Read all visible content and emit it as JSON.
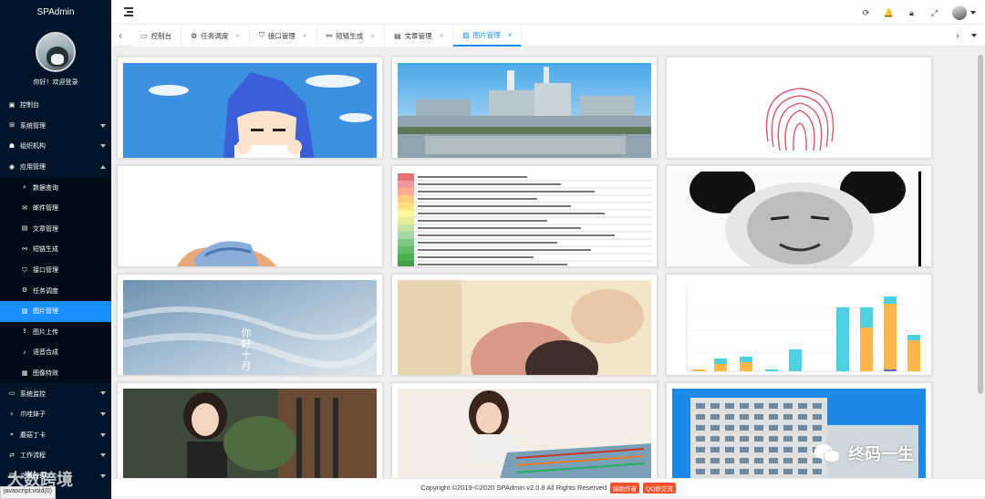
{
  "brand": "SPAdmin",
  "welcome": "你好！欢迎登录",
  "menu": [
    {
      "label": "控制台",
      "icon": "dashboard-icon",
      "type": "top"
    },
    {
      "label": "系统管理",
      "icon": "system-icon",
      "type": "top",
      "caret": "down"
    },
    {
      "label": "组织机构",
      "icon": "org-icon",
      "type": "top",
      "caret": "down"
    },
    {
      "label": "应用管理",
      "icon": "app-icon",
      "type": "top",
      "caret": "up"
    },
    {
      "label": "数据查询",
      "icon": "search-icon",
      "type": "sub"
    },
    {
      "label": "邮件管理",
      "icon": "mail-icon",
      "type": "sub"
    },
    {
      "label": "文章管理",
      "icon": "article-icon",
      "type": "sub"
    },
    {
      "label": "短链生成",
      "icon": "link-icon",
      "type": "sub"
    },
    {
      "label": "接口管理",
      "icon": "shield-icon",
      "type": "sub"
    },
    {
      "label": "任务调度",
      "icon": "gear-icon",
      "type": "sub"
    },
    {
      "label": "图片管理",
      "icon": "image-icon",
      "type": "sub",
      "active": true
    },
    {
      "label": "图片上传",
      "icon": "upload-icon",
      "type": "sub"
    },
    {
      "label": "语音合成",
      "icon": "voice-icon",
      "type": "sub"
    },
    {
      "label": "图像特效",
      "icon": "effect-icon",
      "type": "sub"
    },
    {
      "label": "系统监控",
      "icon": "monitor-icon",
      "type": "top",
      "caret": "down"
    },
    {
      "label": "爪哇妹子",
      "icon": "girl-icon",
      "type": "top",
      "caret": "down"
    },
    {
      "label": "蘑菇丁卡",
      "icon": "location-icon",
      "type": "top",
      "caret": "down"
    },
    {
      "label": "工作流程",
      "icon": "workflow-icon",
      "type": "top",
      "caret": "down"
    },
    {
      "label": "文章管理",
      "icon": "article-icon",
      "type": "top",
      "caret": "down"
    }
  ],
  "header_icons": [
    "refresh-icon",
    "bell-icon",
    "lock-icon",
    "fullscreen-icon"
  ],
  "tabs": [
    {
      "label": "控制台",
      "icon": "monitor-icon",
      "closable": false
    },
    {
      "label": "任务调度",
      "icon": "gear-icon",
      "closable": true
    },
    {
      "label": "接口管理",
      "icon": "shield-icon",
      "closable": true
    },
    {
      "label": "短链生成",
      "icon": "link-icon",
      "closable": true
    },
    {
      "label": "文章管理",
      "icon": "article-icon",
      "closable": true
    },
    {
      "label": "图片管理",
      "icon": "image-icon",
      "closable": true,
      "active": true
    }
  ],
  "images": [
    {
      "name": "anime-girl-image"
    },
    {
      "name": "factory-image"
    },
    {
      "name": "fingerprint-image"
    },
    {
      "name": "straw-hat-image"
    },
    {
      "name": "sql-rules-image"
    },
    {
      "name": "panda-meme-image"
    },
    {
      "name": "sky-poem-image",
      "caption": "你好十月"
    },
    {
      "name": "baby-image"
    },
    {
      "name": "bar-chart-image"
    },
    {
      "name": "portrait-woman-image"
    },
    {
      "name": "woman-sofa-image"
    },
    {
      "name": "building-image"
    }
  ],
  "footer": {
    "copyright": "Copyright ©2019-©2020 SPAdmin v2.0.8 All Rights Reserved",
    "btn1": "捐助作者",
    "btn2": "QQ群交流"
  },
  "status_bar": "javascript:void(0)",
  "watermark_left": "大数跨境",
  "watermark_right": "终码一生",
  "colors": {
    "sidebar": "#001529",
    "active": "#1890ff",
    "footer_btn": "#f5512d"
  }
}
